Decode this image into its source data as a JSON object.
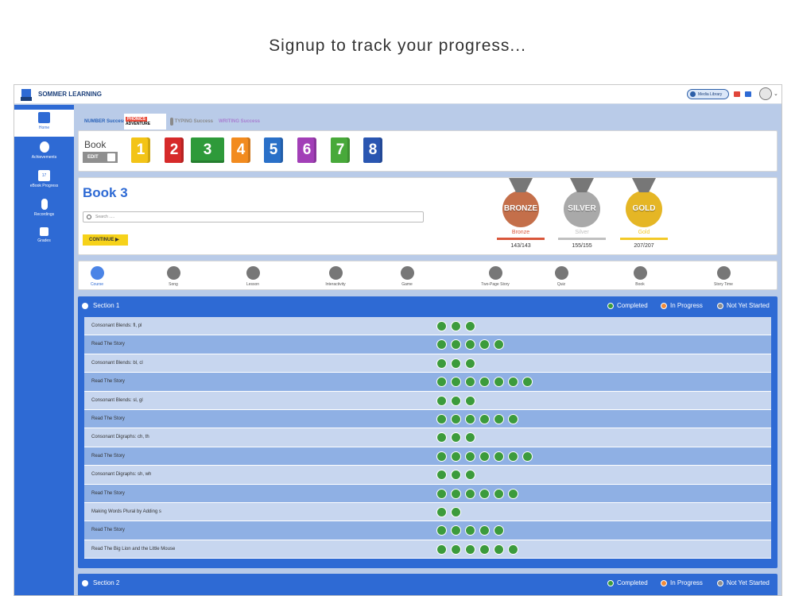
{
  "headline": "Signup to track your progress...",
  "topbar": {
    "brand": "SOMMER LEARNING",
    "media_library": "Media Library"
  },
  "sidebar": {
    "items": [
      {
        "label": "Home",
        "icon": "home-icon"
      },
      {
        "label": "Achievements",
        "icon": "medal-icon"
      },
      {
        "label": "eBook Progress",
        "icon": "book-progress-icon",
        "badge": "17"
      },
      {
        "label": "Recordings",
        "icon": "microphone-icon"
      },
      {
        "label": "Grades",
        "icon": "grades-icon"
      }
    ]
  },
  "product_tabs": [
    {
      "line1": "NUMBER",
      "line2": "Success",
      "color": "#2b63b9"
    },
    {
      "line1": "PHONICS",
      "line2": "ADVENTURE",
      "color": "#1b1b1b"
    },
    {
      "line1": "TYPING",
      "line2": "Success",
      "color": "#8a8a8a"
    },
    {
      "line1": "WRITING",
      "line2": "Success",
      "color": "#a87fd1"
    }
  ],
  "book_selector": {
    "label": "Book",
    "edit": "EDIT",
    "books": [
      {
        "num": "1",
        "color": "#f3c417"
      },
      {
        "num": "2",
        "color": "#d62a2a"
      },
      {
        "num": "3",
        "color": "#2e9a3a"
      },
      {
        "num": "4",
        "color": "#f28b1f"
      },
      {
        "num": "5",
        "color": "#2a70c8"
      },
      {
        "num": "6",
        "color": "#a23fb7"
      },
      {
        "num": "7",
        "color": "#48a93a"
      },
      {
        "num": "8",
        "color": "#2a56b1"
      }
    ]
  },
  "book_panel": {
    "title": "Book 3",
    "search_placeholder": "Search .....",
    "continue": "CONTINUE",
    "medals": [
      {
        "coin": "BRONZE",
        "name": "Bronze",
        "count": "143/143",
        "color": "#c46f4a",
        "bar": "#d9563a"
      },
      {
        "coin": "SILVER",
        "name": "Silver",
        "count": "155/155",
        "color": "#a9a9a9",
        "bar": "#c0c0c0"
      },
      {
        "coin": "GOLD",
        "name": "Gold",
        "count": "207/207",
        "color": "#e5b625",
        "bar": "#f3c928"
      }
    ]
  },
  "activity_types": [
    "Course",
    "Song",
    "Lesson",
    "Interactivity",
    "Game",
    "Two-Page Story",
    "Quiz",
    "Book",
    "Story Time"
  ],
  "legend": {
    "completed": "Completed",
    "in_progress": "In Progress",
    "not_started": "Not Yet Started",
    "completed_color": "#3c9b3c",
    "in_progress_color": "#f28b3a",
    "not_started_color": "#8f8f8f"
  },
  "sections": [
    {
      "title": "Section 1",
      "rows": [
        {
          "label": "Consonant Blends: fl, pl",
          "count": 3
        },
        {
          "label": "Read The Story",
          "count": 5
        },
        {
          "label": "Consonant Blends: bl, cl",
          "count": 3
        },
        {
          "label": "Read The Story",
          "count": 7
        },
        {
          "label": "Consonant Blends: sl, gl",
          "count": 3
        },
        {
          "label": "Read The Story",
          "count": 6
        },
        {
          "label": "Consonant Digraphs: ch, th",
          "count": 3
        },
        {
          "label": "Read The Story",
          "count": 7
        },
        {
          "label": "Consonant Digraphs: sh, wh",
          "count": 3
        },
        {
          "label": "Read The Story",
          "count": 6
        },
        {
          "label": "Making Words Plural by Adding s",
          "count": 2
        },
        {
          "label": "Read The Story",
          "count": 5
        },
        {
          "label": "Read The Big Lion and the Little Mouse",
          "count": 6
        }
      ]
    },
    {
      "title": "Section 2"
    }
  ]
}
